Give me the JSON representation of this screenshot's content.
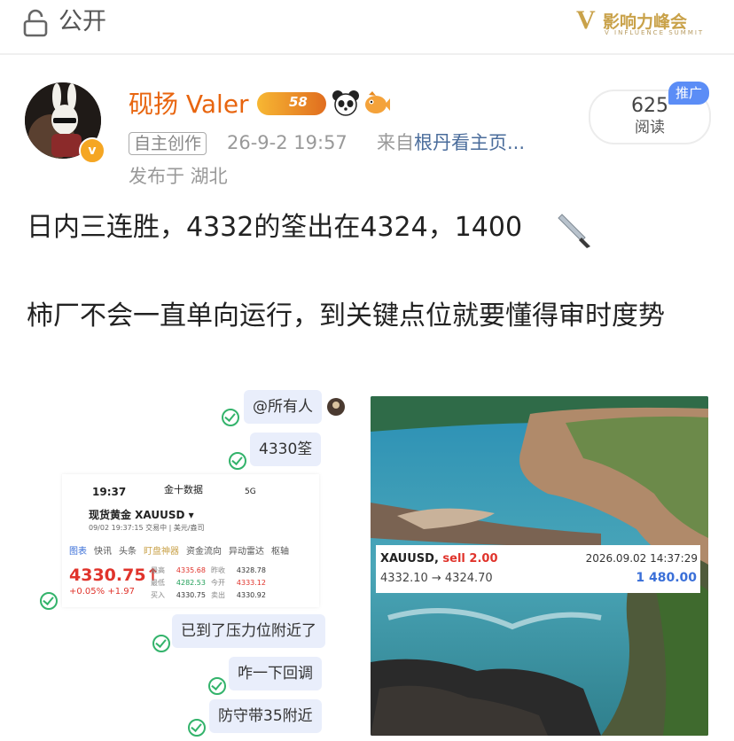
{
  "topbar": {
    "visibility_label": "公开",
    "brand_name": "影响力峰会",
    "brand_en": "V INFLUENCE SUMMIT"
  },
  "post": {
    "author": "砚扬 Valer",
    "level_badge": "58",
    "source_tag": "自主创作",
    "time": "26-9-2 19:57",
    "source_prefix": "来自",
    "source_link": "根丹看主页...",
    "location": "发布于 湖北",
    "read_count": "625",
    "read_label": "阅读",
    "promo_label": "推广",
    "text_line1": "日内三连胜，4332的筌出在4324，1400",
    "text_line2": "柿厂不会一直单向运行，到关键点位就要懂得审时度势"
  },
  "chat_image": {
    "bubbles": [
      "@所有人",
      "4330筌",
      "已到了压力位附近了",
      "咋一下回调",
      "防守带35附近"
    ],
    "quote": {
      "status_time": "19:37",
      "app_name": "金十数据",
      "status_right": "5G",
      "title": "现货黄金  XAUUSD ▾",
      "subtitle": "09/02 19:37:15  交易中  | 美元/盎司",
      "tabs": [
        "图表",
        "快讯",
        "头条",
        "盯盘神器",
        "资金流向",
        "异动雷达",
        "枢轴"
      ],
      "price": "4330.75↑",
      "change": "+0.05%  +1.97",
      "grid": [
        {
          "l1": "最高",
          "v1": "4335.68",
          "l2": "昨收",
          "v2": "4328.78"
        },
        {
          "l1": "最低",
          "v1": "4282.53",
          "l2": "今开",
          "v2": "4333.12"
        },
        {
          "l1": "买入",
          "v1": "4330.75",
          "l2": "卖出",
          "v2": "4330.92"
        }
      ]
    }
  },
  "trade_card": {
    "symbol": "XAUUSD,",
    "side": "sell 2.00",
    "datetime": "2026.09.02 14:37:29",
    "range": "4332.10 → 4324.70",
    "profit": "1 480.00"
  },
  "colors": {
    "author": "#e8650f",
    "link": "#4a6c9b",
    "promo": "#5b8df6",
    "price_red": "#e0332b",
    "profit_blue": "#3a6fd8"
  },
  "icons": [
    "lock-icon",
    "verified-icon",
    "panda-icon",
    "fish-icon",
    "knife-icon",
    "check-icon"
  ]
}
